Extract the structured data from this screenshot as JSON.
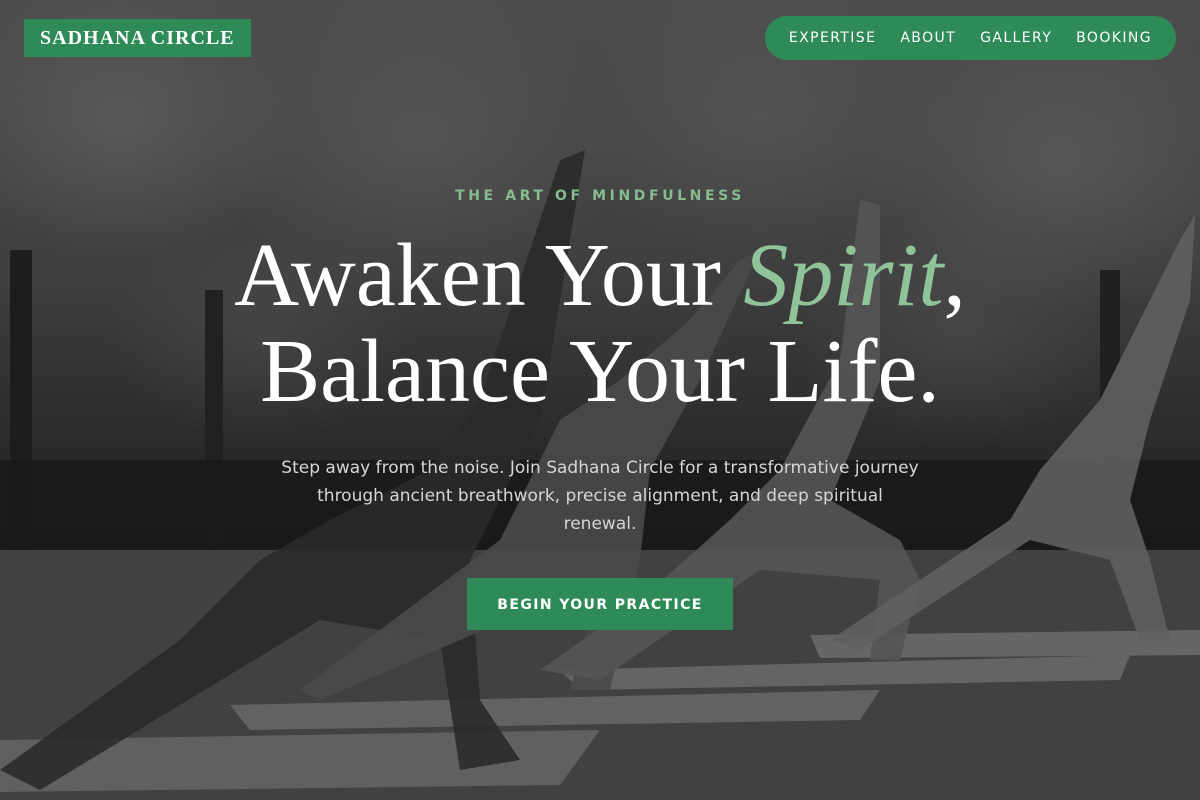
{
  "brand": {
    "name": "SADHANA CIRCLE",
    "color": "#2e8b57"
  },
  "nav": {
    "items": [
      {
        "label": "EXPERTISE"
      },
      {
        "label": "ABOUT"
      },
      {
        "label": "GALLERY"
      },
      {
        "label": "BOOKING"
      }
    ]
  },
  "hero": {
    "eyebrow": "THE ART OF MINDFULNESS",
    "headline_line1_before": "Awaken Your ",
    "headline_accent": "Spirit",
    "headline_line1_after": ",",
    "headline_line2": "Balance Your Life.",
    "subtitle": "Step away from the noise. Join Sadhana Circle for a transformative journey through ancient breathwork, precise alignment, and deep spiritual renewal.",
    "cta_label": "BEGIN YOUR PRACTICE",
    "accent_color": "#8fc49a"
  }
}
